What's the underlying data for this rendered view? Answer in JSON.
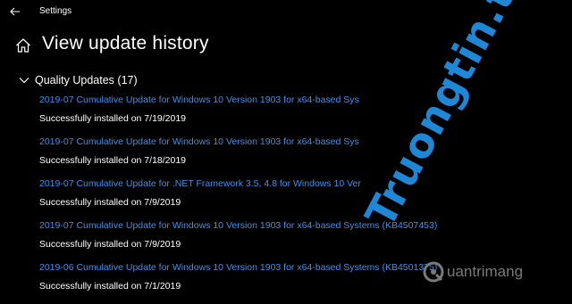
{
  "window": {
    "title": "Settings",
    "back_icon": "arrow-left-icon"
  },
  "header": {
    "home_icon": "home-icon",
    "title": "View update history"
  },
  "section": {
    "label": "Quality Updates (17)",
    "icon": "chevron-down-icon"
  },
  "updates": [
    {
      "name": "2019-07 Cumulative Update for Windows 10 Version 1903 for x64-based Sys",
      "status": "Successfully installed on 7/19/2019"
    },
    {
      "name": "2019-07 Cumulative Update for Windows 10 Version 1903 for x64-based Sys",
      "status": "Successfully installed on 7/18/2019"
    },
    {
      "name": "2019-07 Cumulative Update for .NET Framework 3.5, 4.8 for Windows 10 Ver",
      "status": "Successfully installed on 7/9/2019"
    },
    {
      "name": "2019-07 Cumulative Update for Windows 10 Version 1903 for x64-based Systems (KB4507453)",
      "status": "Successfully installed on 7/9/2019"
    },
    {
      "name": "2019-06 Cumulative Update for Windows 10 Version 1903 for x64-based Systems (KB4501375)",
      "status": "Successfully installed on 7/1/2019"
    }
  ],
  "watermark": {
    "text": "Truongtin.top",
    "logo_text": "uantrimang"
  },
  "colors": {
    "background": "#000000",
    "link": "#3f8fe8",
    "text": "#ffffff",
    "watermark": "#1e87d6"
  }
}
